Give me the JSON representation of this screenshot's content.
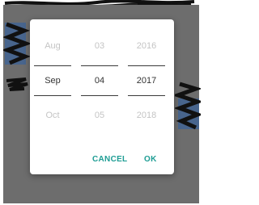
{
  "picker": {
    "month": {
      "prev": "Aug",
      "selected": "Sep",
      "next": "Oct"
    },
    "day": {
      "prev": "03",
      "selected": "04",
      "next": "05"
    },
    "year": {
      "prev": "2016",
      "selected": "2017",
      "next": "2018"
    }
  },
  "buttons": {
    "cancel": "CANCEL",
    "ok": "OK"
  },
  "colors": {
    "accent": "#1e9d94",
    "scrim": "#6d6d6d",
    "dim_text": "#c4c4c4",
    "selected_text": "#333333",
    "scribble_blue": "#2a5fa8"
  }
}
